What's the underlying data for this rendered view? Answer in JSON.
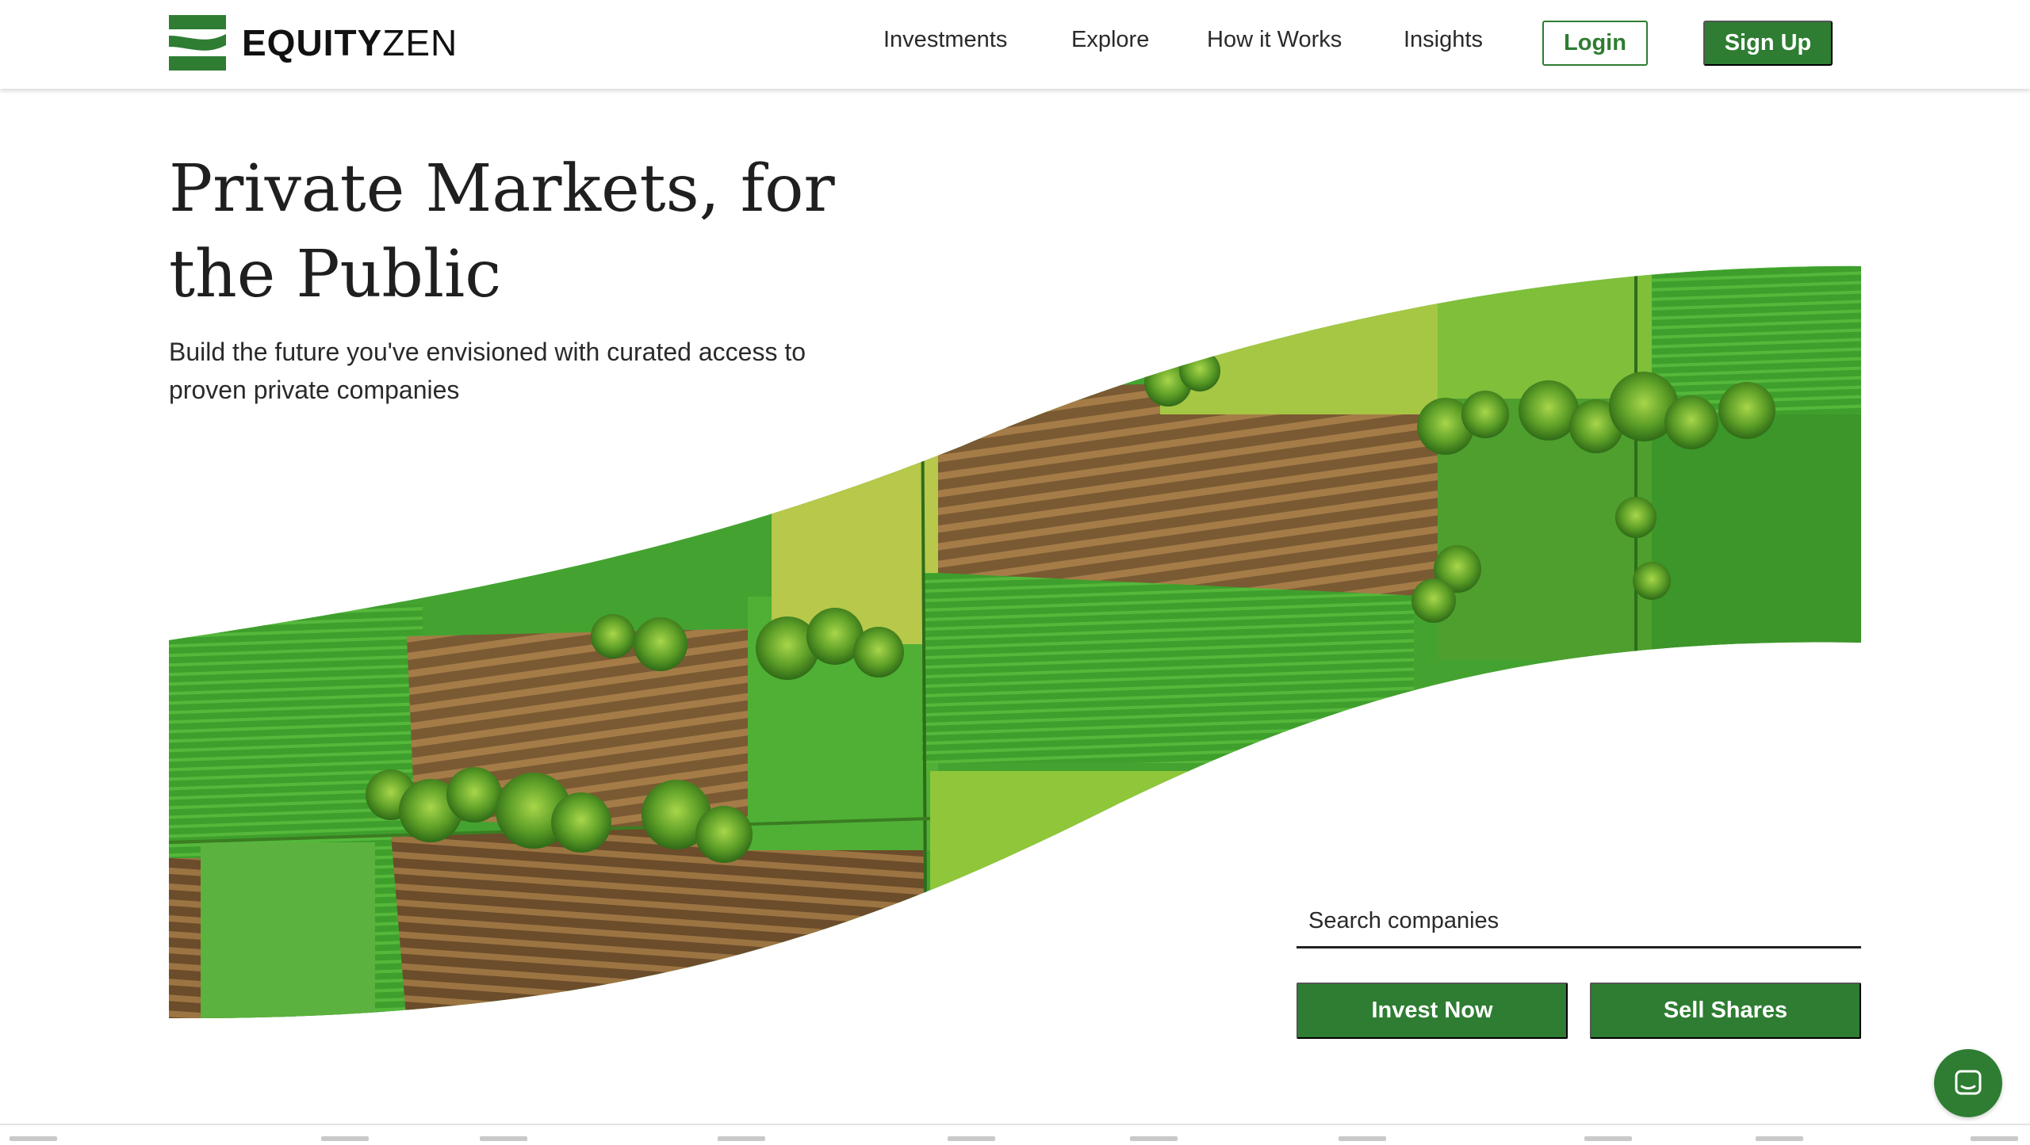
{
  "brand": {
    "name_bold": "EQUITY",
    "name_light": "ZEN",
    "color": "#2e7d32"
  },
  "nav": {
    "items": [
      {
        "label": "Investments"
      },
      {
        "label": "Explore"
      },
      {
        "label": "How it Works"
      },
      {
        "label": "Insights"
      }
    ],
    "login_label": "Login",
    "signup_label": "Sign Up"
  },
  "hero": {
    "title": "Private Markets, for the Public",
    "subtitle": "Build the future you've envisioned with curated access to proven private companies"
  },
  "search": {
    "placeholder": "Search companies",
    "value": ""
  },
  "cta": {
    "invest_label": "Invest Now",
    "sell_label": "Sell Shares"
  },
  "icons": {
    "logo": "equityzen-logo-icon",
    "chat": "chat-icon"
  }
}
